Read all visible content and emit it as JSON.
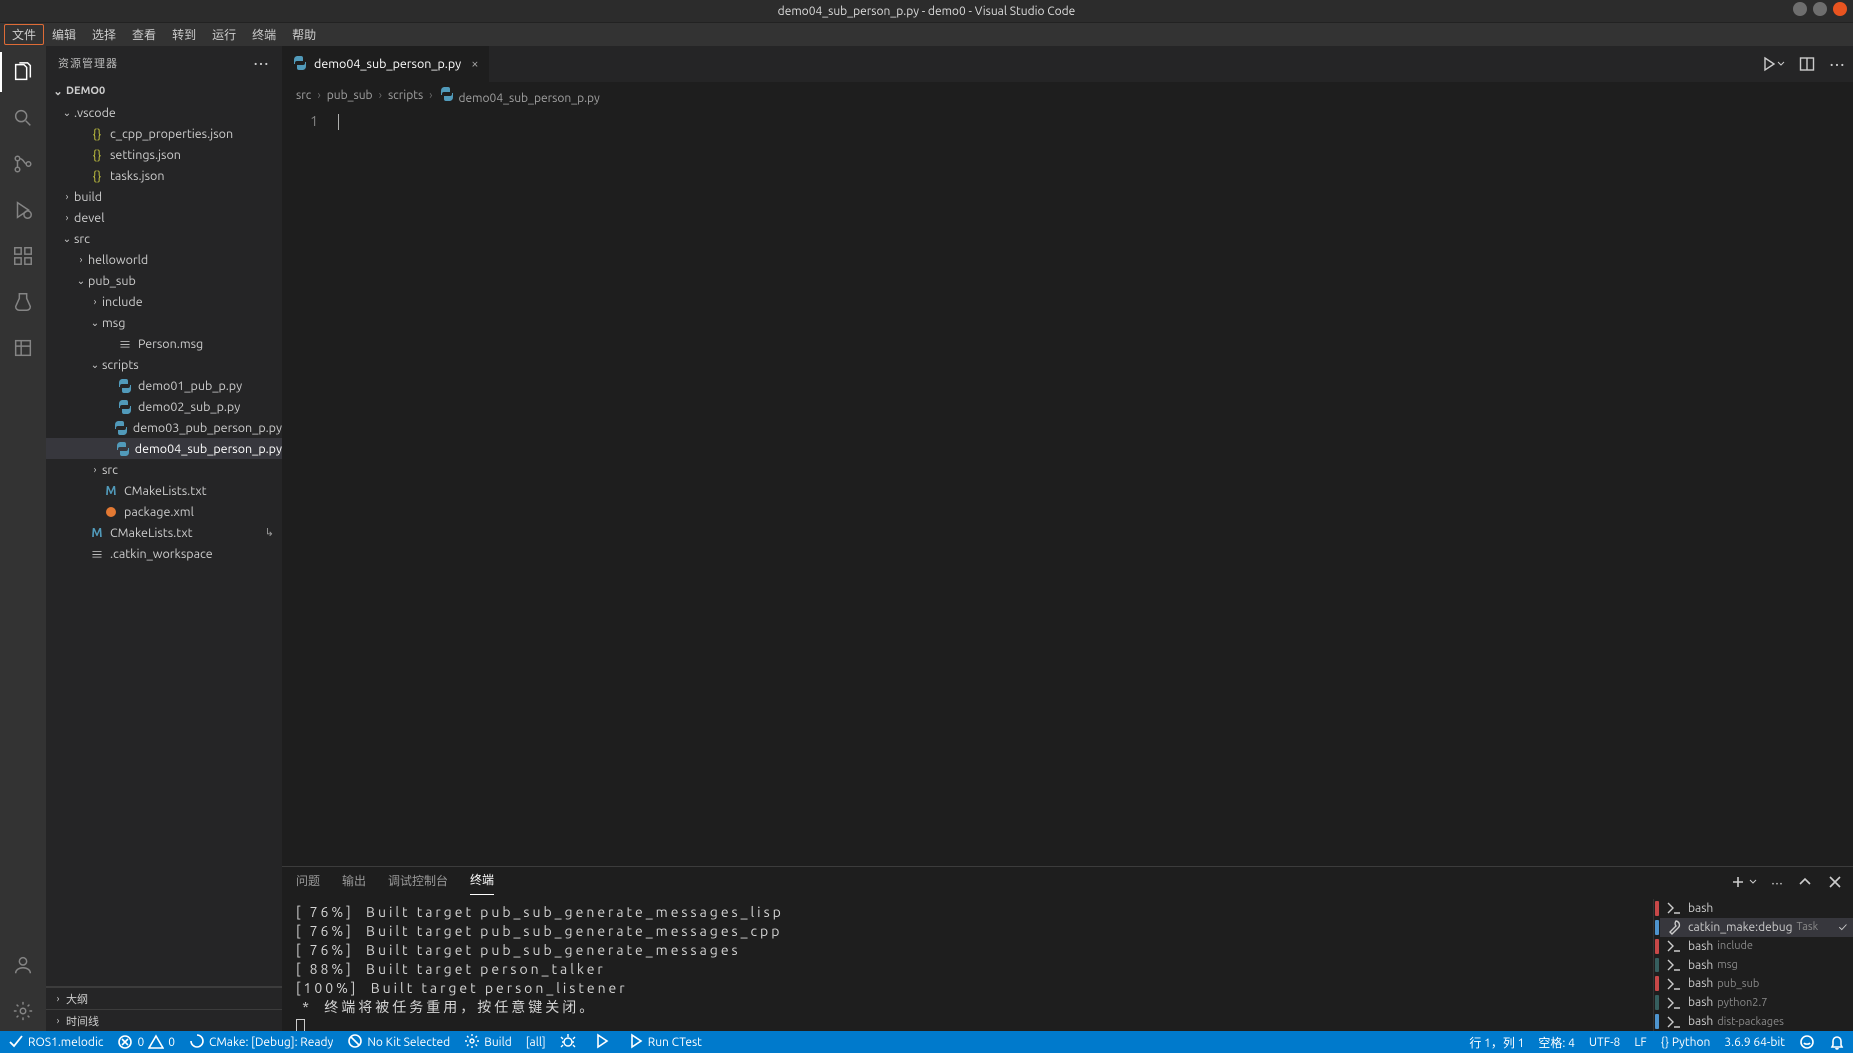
{
  "title": "demo04_sub_person_p.py - demo0 - Visual Studio Code",
  "menus": [
    "文件",
    "编辑",
    "选择",
    "查看",
    "转到",
    "运行",
    "终端",
    "帮助"
  ],
  "sidebar": {
    "title": "资源管理器",
    "project": "DEMO0",
    "outline": "大纲",
    "timeline": "时间线"
  },
  "tree": [
    {
      "d": 1,
      "k": "foldopen",
      "name": ".vscode"
    },
    {
      "d": 2,
      "k": "json",
      "name": "c_cpp_properties.json"
    },
    {
      "d": 2,
      "k": "json",
      "name": "settings.json"
    },
    {
      "d": 2,
      "k": "json",
      "name": "tasks.json"
    },
    {
      "d": 1,
      "k": "fold",
      "name": "build"
    },
    {
      "d": 1,
      "k": "fold",
      "name": "devel"
    },
    {
      "d": 1,
      "k": "foldopen",
      "name": "src"
    },
    {
      "d": 2,
      "k": "fold",
      "name": "helloworld"
    },
    {
      "d": 2,
      "k": "foldopen",
      "name": "pub_sub"
    },
    {
      "d": 3,
      "k": "fold",
      "name": "include"
    },
    {
      "d": 3,
      "k": "foldopen",
      "name": "msg"
    },
    {
      "d": 4,
      "k": "msg",
      "name": "Person.msg"
    },
    {
      "d": 3,
      "k": "foldopen",
      "name": "scripts"
    },
    {
      "d": 4,
      "k": "py",
      "name": "demo01_pub_p.py"
    },
    {
      "d": 4,
      "k": "py",
      "name": "demo02_sub_p.py"
    },
    {
      "d": 4,
      "k": "py",
      "name": "demo03_pub_person_p.py"
    },
    {
      "d": 4,
      "k": "py",
      "name": "demo04_sub_person_p.py",
      "selected": true
    },
    {
      "d": 3,
      "k": "fold",
      "name": "src"
    },
    {
      "d": 3,
      "k": "cmake",
      "name": "CMakeLists.txt"
    },
    {
      "d": 3,
      "k": "xml",
      "name": "package.xml"
    },
    {
      "d": 2,
      "k": "cmake",
      "name": "CMakeLists.txt",
      "tail": "↳"
    },
    {
      "d": 2,
      "k": "file",
      "name": ".catkin_workspace"
    }
  ],
  "tab": {
    "label": "demo04_sub_person_p.py"
  },
  "crumbs": [
    "src",
    "pub_sub",
    "scripts",
    "demo04_sub_person_p.py"
  ],
  "editor": {
    "line": "1"
  },
  "panelTabs": [
    "问题",
    "输出",
    "调试控制台",
    "终端"
  ],
  "panelActive": 3,
  "terminal": {
    "lines": [
      "[ 76%]  Built target pub_sub_generate_messages_lisp",
      "[ 76%]  Built target pub_sub_generate_messages_cpp",
      "[ 76%]  Built target pub_sub_generate_messages",
      "[ 88%]  Built target person_talker",
      "[100%]  Built target person_listener",
      " *  终端将被任务重用，按任意键关闭。"
    ]
  },
  "termList": [
    {
      "icon": "sh",
      "label": "bash",
      "sub": ""
    },
    {
      "icon": "wr",
      "label": "catkin_make:debug",
      "sub": "Task",
      "selected": true,
      "check": true
    },
    {
      "icon": "sh",
      "label": "bash",
      "sub": "include"
    },
    {
      "icon": "sh",
      "label": "bash",
      "sub": "msg"
    },
    {
      "icon": "sh",
      "label": "bash",
      "sub": "pub_sub"
    },
    {
      "icon": "sh",
      "label": "bash",
      "sub": "python2.7"
    },
    {
      "icon": "sh",
      "label": "bash",
      "sub": "dist-packages"
    }
  ],
  "status": {
    "left": [
      {
        "icon": "check",
        "text": "ROS1.melodic"
      },
      {
        "icon": "errwarn",
        "text": ""
      },
      {
        "icon": "spin",
        "text": "CMake: [Debug]: Ready"
      },
      {
        "icon": "stop",
        "text": "No Kit Selected"
      },
      {
        "icon": "gear",
        "text": "Build"
      },
      {
        "icon": "",
        "text": "[all]"
      },
      {
        "icon": "bug",
        "text": ""
      },
      {
        "icon": "play",
        "text": ""
      },
      {
        "icon": "play",
        "text": "Run CTest"
      }
    ],
    "errwarn": {
      "err": "0",
      "warn": "0"
    },
    "right": [
      "行 1，列 1",
      "空格: 4",
      "UTF-8",
      "LF",
      "{} Python",
      "3.6.9 64-bit"
    ]
  }
}
